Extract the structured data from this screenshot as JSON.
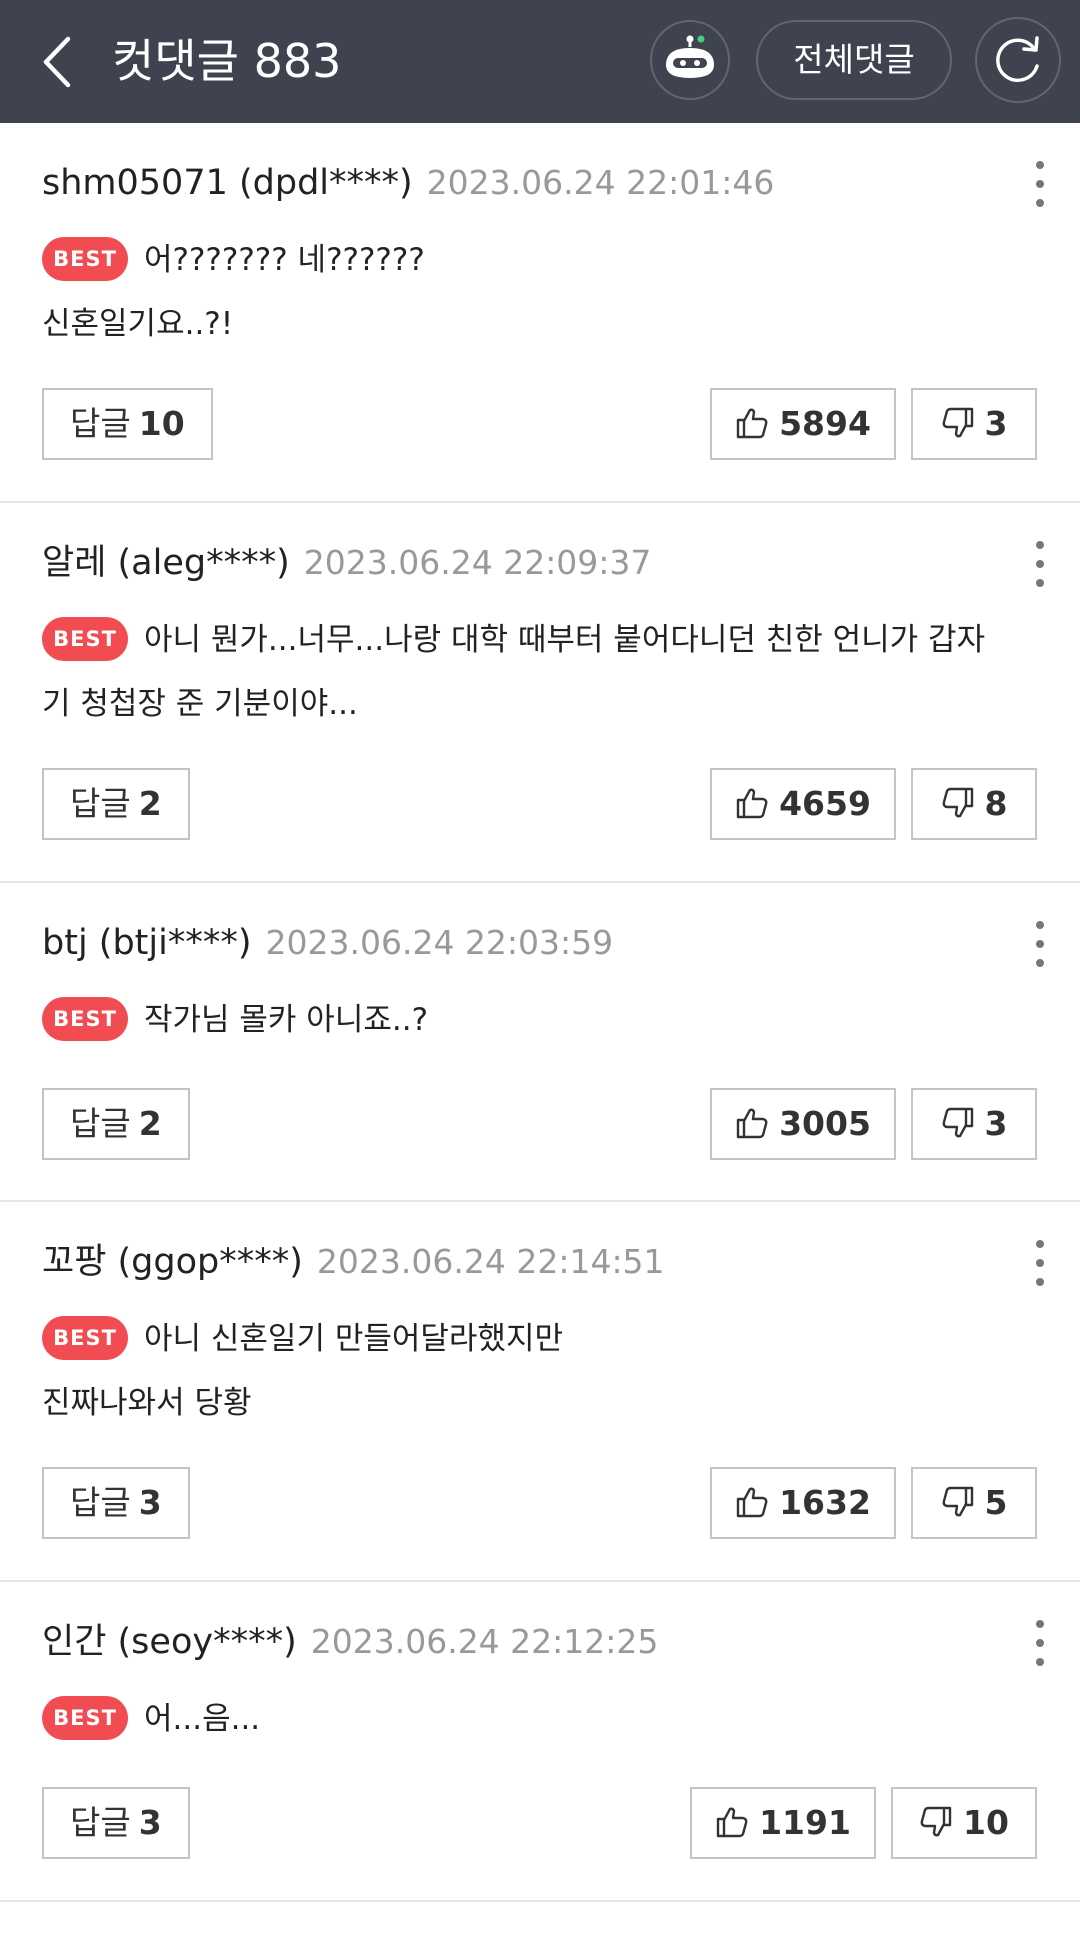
{
  "header": {
    "title": "컷댓글 883",
    "all_comments_label": "전체댓글"
  },
  "badge_label": "BEST",
  "reply_label": "답글",
  "comments": [
    {
      "author": "shm05071 (dpdl****)",
      "date": "2023.06.24 22:01:46",
      "text": "어??????? 네??????\n신혼일기요..?!",
      "replies": "10",
      "likes": "5894",
      "dislikes": "3"
    },
    {
      "author": "알레 (aleg****)",
      "date": "2023.06.24 22:09:37",
      "text": "아니 뭔가...너무...나랑 대학 때부터 붙어다니던 친한 언니가 갑자\n기 청첩장 준 기분이야...",
      "replies": "2",
      "likes": "4659",
      "dislikes": "8"
    },
    {
      "author": "btj (btji****)",
      "date": "2023.06.24 22:03:59",
      "text": "작가님 몰카 아니죠..?",
      "replies": "2",
      "likes": "3005",
      "dislikes": "3"
    },
    {
      "author": "꼬팡 (ggop****)",
      "date": "2023.06.24 22:14:51",
      "text": "아니 신혼일기 만들어달라했지만\n진짜나와서 당황",
      "replies": "3",
      "likes": "1632",
      "dislikes": "5"
    },
    {
      "author": "인간 (seoy****)",
      "date": "2023.06.24 22:12:25",
      "text": "어...음...",
      "replies": "3",
      "likes": "1191",
      "dislikes": "10"
    }
  ]
}
